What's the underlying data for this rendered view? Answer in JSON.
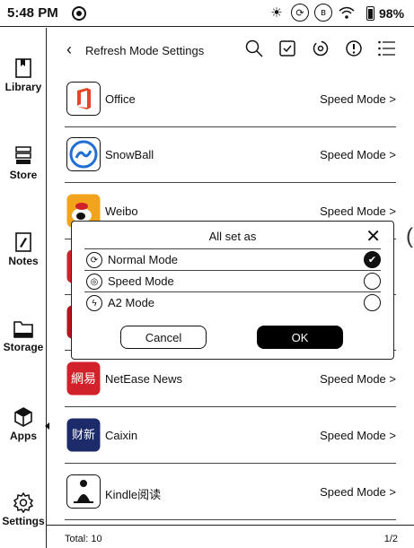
{
  "status_bar": {
    "time": "5:48 PM",
    "battery": "98%",
    "icons": [
      "sync-icon",
      "brightness-icon",
      "refresh-icon",
      "bluetooth-icon",
      "wifi-icon",
      "battery-icon"
    ]
  },
  "sidebar": {
    "items": [
      {
        "label": "Library",
        "icon": "library-icon"
      },
      {
        "label": "Store",
        "icon": "store-icon"
      },
      {
        "label": "Notes",
        "icon": "notes-icon"
      },
      {
        "label": "Storage",
        "icon": "storage-icon"
      },
      {
        "label": "Apps",
        "icon": "apps-icon"
      },
      {
        "label": "Settings",
        "icon": "settings-icon"
      }
    ]
  },
  "header": {
    "title": "Refresh Mode Settings",
    "icons": [
      "search-icon",
      "select-all-icon",
      "refresh-mode-icon",
      "info-icon",
      "menu-icon"
    ]
  },
  "apps": [
    {
      "name": "Office",
      "mode": "Speed Mode >"
    },
    {
      "name": "SnowBall",
      "mode": "Speed Mode >"
    },
    {
      "name": "Weibo",
      "mode": "Speed Mode >"
    },
    {
      "name": "",
      "mode": ""
    },
    {
      "name": "",
      "mode": ""
    },
    {
      "name": "NetEase News",
      "mode": "Speed Mode >"
    },
    {
      "name": "Caixin",
      "mode": "Speed Mode >"
    },
    {
      "name": "Kindle阅读",
      "mode": "Speed Mode >"
    }
  ],
  "dialog": {
    "title": "All set as",
    "options": [
      {
        "label": "Normal Mode",
        "selected": true
      },
      {
        "label": "Speed Mode",
        "selected": false
      },
      {
        "label": "A2 Mode",
        "selected": false
      }
    ],
    "cancel": "Cancel",
    "ok": "OK"
  },
  "footer": {
    "total": "Total: 10",
    "page": "1/2"
  },
  "colors": {
    "office_red": "#e8442a",
    "snowball_blue": "#1f6fd6",
    "weibo_orange": "#f2a41c",
    "netease_red": "#d1212b",
    "caixin_navy": "#1d2b6b"
  }
}
